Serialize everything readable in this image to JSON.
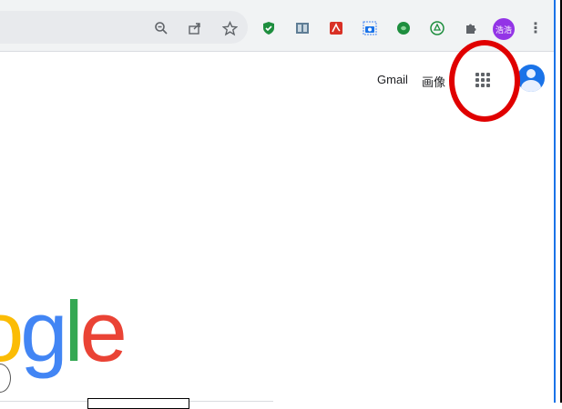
{
  "toolbar": {
    "icons": [
      "zoom-icon",
      "share-icon",
      "bookmark-star-icon"
    ],
    "extensions": [
      "shield-extension-icon",
      "reader-extension-icon",
      "pdf-extension-icon",
      "screenshot-extension-icon",
      "green-extension-icon",
      "recycle-extension-icon",
      "puzzle-extensions-icon"
    ],
    "profile_label": "浩浩",
    "menu_glyph": "⋮"
  },
  "header_links": {
    "gmail": "Gmail",
    "images": "画像"
  },
  "logo": {
    "letters": [
      {
        "char": "o",
        "color": "#fbbc05"
      },
      {
        "char": "g",
        "color": "#4285f4"
      },
      {
        "char": "l",
        "color": "#34a853"
      },
      {
        "char": "e",
        "color": "#ea4335"
      }
    ]
  },
  "annotation": {
    "color": "#e00000",
    "target": "apps-grid-button"
  }
}
